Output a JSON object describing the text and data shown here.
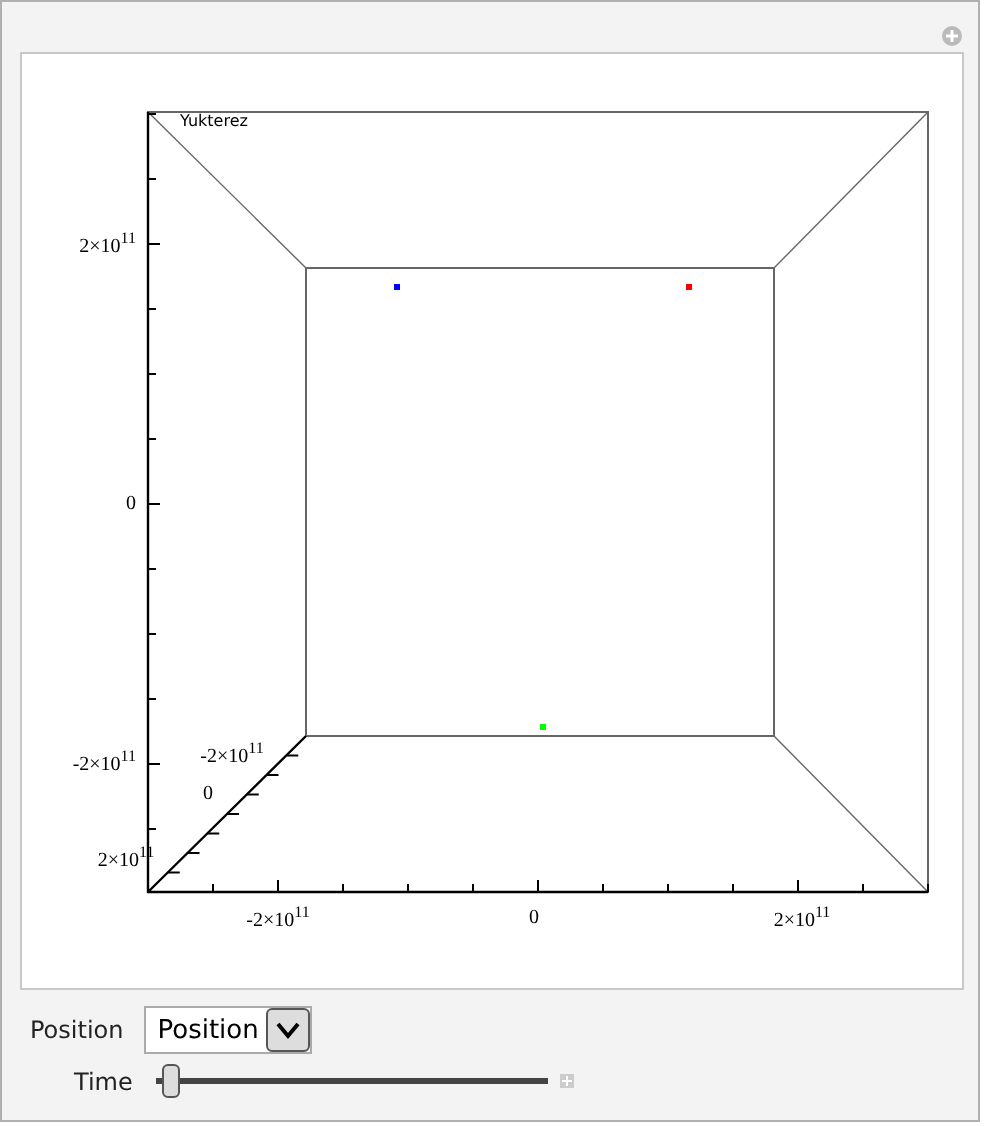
{
  "plot": {
    "title": "Yukterez",
    "vertical_ticks": [
      "2×10$^{11}$",
      "0",
      "-2×10$^{11}$"
    ],
    "depth_ticks": [
      "-2×10$^{11}$",
      "0",
      "2×10$^{11}$"
    ],
    "horizontal_ticks": [
      "-2×10$^{11}$",
      "0",
      "2×10$^{11}$"
    ],
    "points": [
      {
        "color": "#0000ff"
      },
      {
        "color": "#ff0000"
      },
      {
        "color": "#00ff00"
      }
    ]
  },
  "controls": {
    "position_label": "Position",
    "position_value": "Position",
    "time_label": "Time",
    "time": {
      "level": 0
    }
  }
}
